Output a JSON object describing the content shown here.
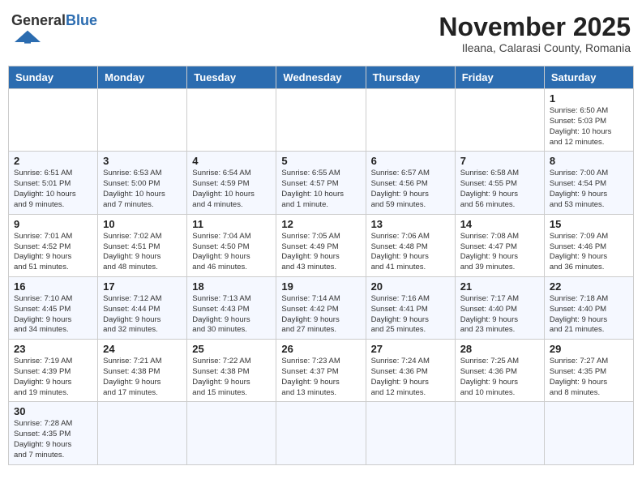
{
  "header": {
    "logo_general": "General",
    "logo_blue": "Blue",
    "title": "November 2025",
    "subtitle": "Ileana, Calarasi County, Romania"
  },
  "weekdays": [
    "Sunday",
    "Monday",
    "Tuesday",
    "Wednesday",
    "Thursday",
    "Friday",
    "Saturday"
  ],
  "weeks": [
    [
      {
        "day": "",
        "info": ""
      },
      {
        "day": "",
        "info": ""
      },
      {
        "day": "",
        "info": ""
      },
      {
        "day": "",
        "info": ""
      },
      {
        "day": "",
        "info": ""
      },
      {
        "day": "",
        "info": ""
      },
      {
        "day": "1",
        "info": "Sunrise: 6:50 AM\nSunset: 5:03 PM\nDaylight: 10 hours\nand 12 minutes."
      }
    ],
    [
      {
        "day": "2",
        "info": "Sunrise: 6:51 AM\nSunset: 5:01 PM\nDaylight: 10 hours\nand 9 minutes."
      },
      {
        "day": "3",
        "info": "Sunrise: 6:53 AM\nSunset: 5:00 PM\nDaylight: 10 hours\nand 7 minutes."
      },
      {
        "day": "4",
        "info": "Sunrise: 6:54 AM\nSunset: 4:59 PM\nDaylight: 10 hours\nand 4 minutes."
      },
      {
        "day": "5",
        "info": "Sunrise: 6:55 AM\nSunset: 4:57 PM\nDaylight: 10 hours\nand 1 minute."
      },
      {
        "day": "6",
        "info": "Sunrise: 6:57 AM\nSunset: 4:56 PM\nDaylight: 9 hours\nand 59 minutes."
      },
      {
        "day": "7",
        "info": "Sunrise: 6:58 AM\nSunset: 4:55 PM\nDaylight: 9 hours\nand 56 minutes."
      },
      {
        "day": "8",
        "info": "Sunrise: 7:00 AM\nSunset: 4:54 PM\nDaylight: 9 hours\nand 53 minutes."
      }
    ],
    [
      {
        "day": "9",
        "info": "Sunrise: 7:01 AM\nSunset: 4:52 PM\nDaylight: 9 hours\nand 51 minutes."
      },
      {
        "day": "10",
        "info": "Sunrise: 7:02 AM\nSunset: 4:51 PM\nDaylight: 9 hours\nand 48 minutes."
      },
      {
        "day": "11",
        "info": "Sunrise: 7:04 AM\nSunset: 4:50 PM\nDaylight: 9 hours\nand 46 minutes."
      },
      {
        "day": "12",
        "info": "Sunrise: 7:05 AM\nSunset: 4:49 PM\nDaylight: 9 hours\nand 43 minutes."
      },
      {
        "day": "13",
        "info": "Sunrise: 7:06 AM\nSunset: 4:48 PM\nDaylight: 9 hours\nand 41 minutes."
      },
      {
        "day": "14",
        "info": "Sunrise: 7:08 AM\nSunset: 4:47 PM\nDaylight: 9 hours\nand 39 minutes."
      },
      {
        "day": "15",
        "info": "Sunrise: 7:09 AM\nSunset: 4:46 PM\nDaylight: 9 hours\nand 36 minutes."
      }
    ],
    [
      {
        "day": "16",
        "info": "Sunrise: 7:10 AM\nSunset: 4:45 PM\nDaylight: 9 hours\nand 34 minutes."
      },
      {
        "day": "17",
        "info": "Sunrise: 7:12 AM\nSunset: 4:44 PM\nDaylight: 9 hours\nand 32 minutes."
      },
      {
        "day": "18",
        "info": "Sunrise: 7:13 AM\nSunset: 4:43 PM\nDaylight: 9 hours\nand 30 minutes."
      },
      {
        "day": "19",
        "info": "Sunrise: 7:14 AM\nSunset: 4:42 PM\nDaylight: 9 hours\nand 27 minutes."
      },
      {
        "day": "20",
        "info": "Sunrise: 7:16 AM\nSunset: 4:41 PM\nDaylight: 9 hours\nand 25 minutes."
      },
      {
        "day": "21",
        "info": "Sunrise: 7:17 AM\nSunset: 4:40 PM\nDaylight: 9 hours\nand 23 minutes."
      },
      {
        "day": "22",
        "info": "Sunrise: 7:18 AM\nSunset: 4:40 PM\nDaylight: 9 hours\nand 21 minutes."
      }
    ],
    [
      {
        "day": "23",
        "info": "Sunrise: 7:19 AM\nSunset: 4:39 PM\nDaylight: 9 hours\nand 19 minutes."
      },
      {
        "day": "24",
        "info": "Sunrise: 7:21 AM\nSunset: 4:38 PM\nDaylight: 9 hours\nand 17 minutes."
      },
      {
        "day": "25",
        "info": "Sunrise: 7:22 AM\nSunset: 4:38 PM\nDaylight: 9 hours\nand 15 minutes."
      },
      {
        "day": "26",
        "info": "Sunrise: 7:23 AM\nSunset: 4:37 PM\nDaylight: 9 hours\nand 13 minutes."
      },
      {
        "day": "27",
        "info": "Sunrise: 7:24 AM\nSunset: 4:36 PM\nDaylight: 9 hours\nand 12 minutes."
      },
      {
        "day": "28",
        "info": "Sunrise: 7:25 AM\nSunset: 4:36 PM\nDaylight: 9 hours\nand 10 minutes."
      },
      {
        "day": "29",
        "info": "Sunrise: 7:27 AM\nSunset: 4:35 PM\nDaylight: 9 hours\nand 8 minutes."
      }
    ],
    [
      {
        "day": "30",
        "info": "Sunrise: 7:28 AM\nSunset: 4:35 PM\nDaylight: 9 hours\nand 7 minutes."
      },
      {
        "day": "",
        "info": ""
      },
      {
        "day": "",
        "info": ""
      },
      {
        "day": "",
        "info": ""
      },
      {
        "day": "",
        "info": ""
      },
      {
        "day": "",
        "info": ""
      },
      {
        "day": "",
        "info": ""
      }
    ]
  ]
}
